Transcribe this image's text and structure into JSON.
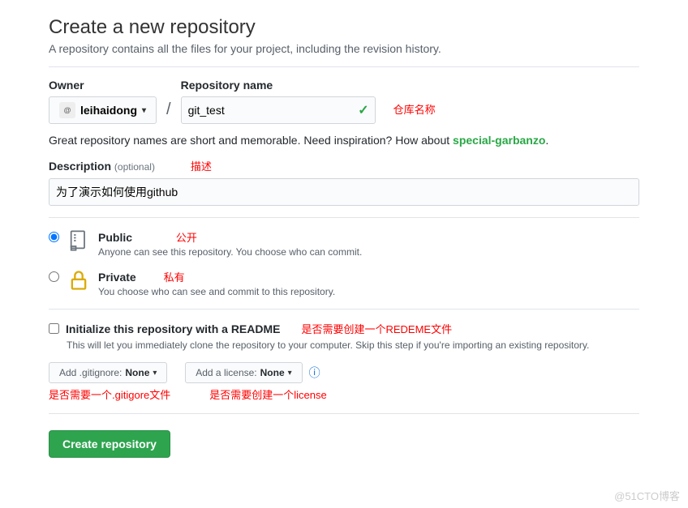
{
  "header": {
    "title": "Create a new repository",
    "subtitle": "A repository contains all the files for your project, including the revision history."
  },
  "owner": {
    "label": "Owner",
    "avatar_text": "@",
    "username": "leihaidong"
  },
  "repo": {
    "label": "Repository name",
    "value": "git_test",
    "annotation": "仓库名称"
  },
  "hint": {
    "text_prefix": "Great repository names are short and memorable. Need inspiration? How about ",
    "suggestion": "special-garbanzo",
    "suffix": "."
  },
  "description": {
    "label": "Description",
    "optional": "(optional)",
    "annotation": "描述",
    "value": "为了演示如何使用github"
  },
  "visibility": {
    "public": {
      "title": "Public",
      "annotation": "公开",
      "sub": "Anyone can see this repository. You choose who can commit."
    },
    "private": {
      "title": "Private",
      "annotation": "私有",
      "sub": "You choose who can see and commit to this repository."
    }
  },
  "init": {
    "label": "Initialize this repository with a README",
    "annotation": "是否需要创建一个REDEME文件",
    "sub": "This will let you immediately clone the repository to your computer. Skip this step if you're importing an existing repository."
  },
  "gitignore": {
    "prefix": "Add .gitignore: ",
    "value": "None",
    "annotation": "是否需要一个.gitigore文件"
  },
  "license": {
    "prefix": "Add a license: ",
    "value": "None",
    "annotation": "是否需要创建一个license"
  },
  "submit": {
    "label": "Create repository"
  },
  "watermark": "@51CTO博客"
}
